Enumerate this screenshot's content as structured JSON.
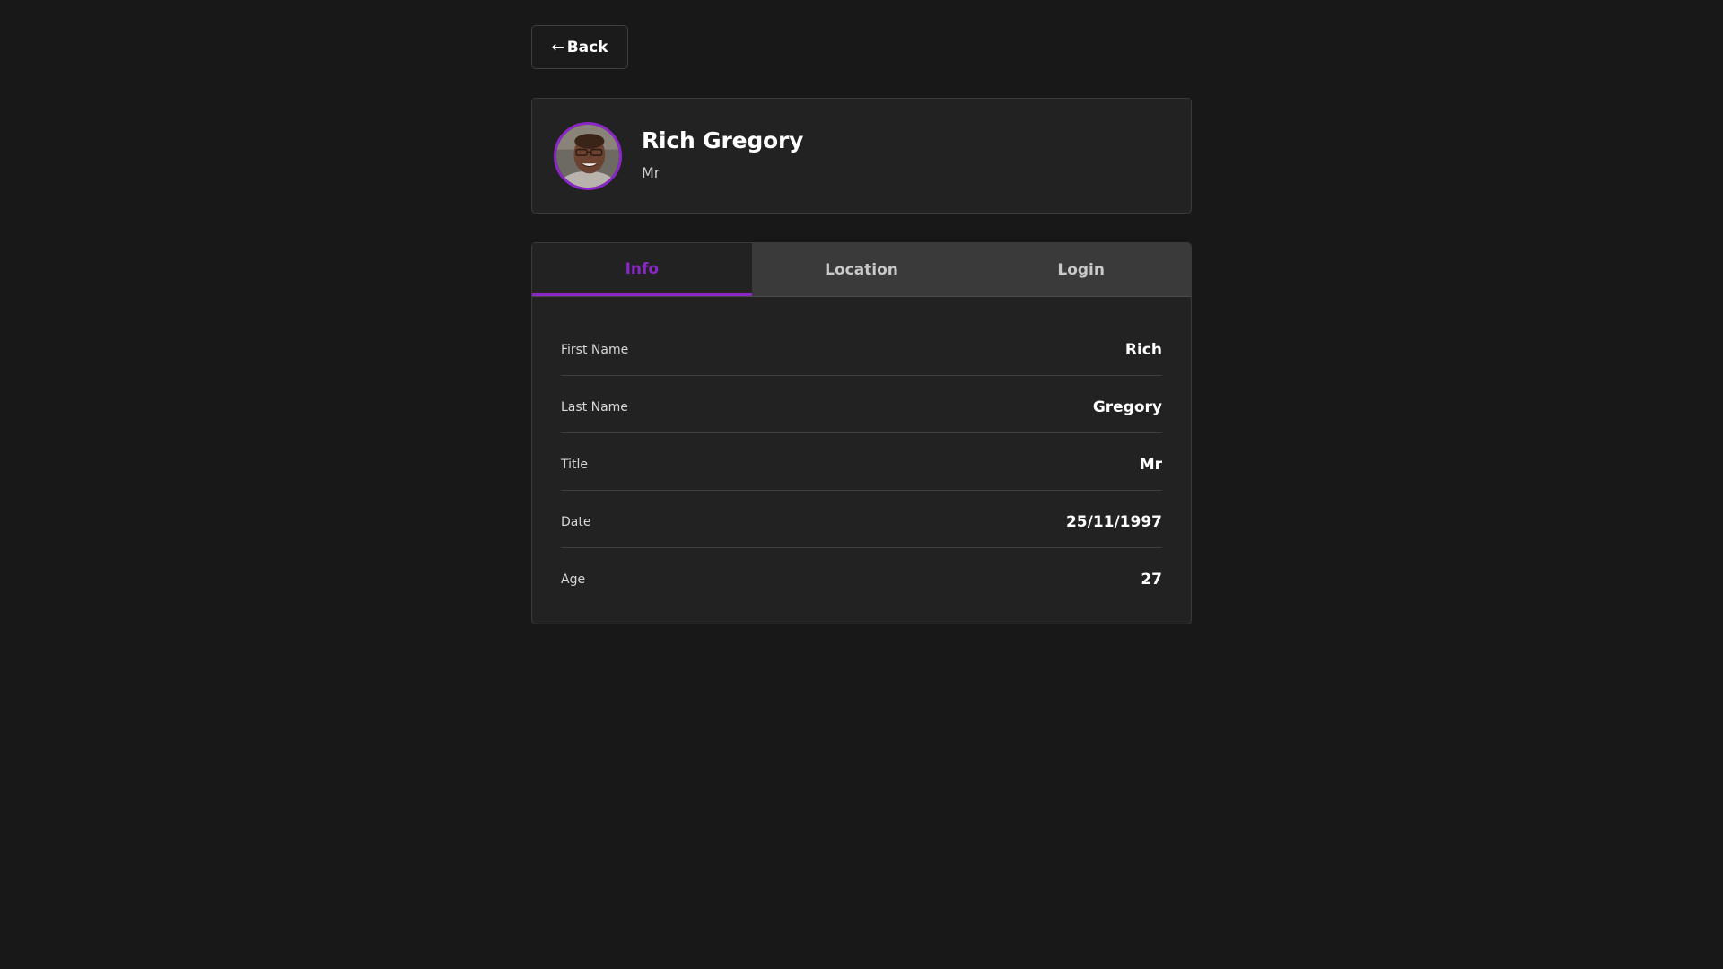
{
  "back_button": {
    "arrow": "←",
    "label": "Back"
  },
  "profile": {
    "name": "Rich Gregory",
    "title": "Mr"
  },
  "tabs": [
    {
      "label": "Info",
      "active": true
    },
    {
      "label": "Location",
      "active": false
    },
    {
      "label": "Login",
      "active": false
    }
  ],
  "info_rows": [
    {
      "label": "First Name",
      "value": "Rich"
    },
    {
      "label": "Last Name",
      "value": "Gregory"
    },
    {
      "label": "Title",
      "value": "Mr"
    },
    {
      "label": "Date",
      "value": "25/11/1997"
    },
    {
      "label": "Age",
      "value": "27"
    }
  ],
  "colors": {
    "background": "#181818",
    "card": "#222222",
    "accent": "#8b26c7",
    "tab_bar": "#3a3a3a"
  },
  "icons": {
    "back": "arrow-left-icon",
    "avatar": "user-photo"
  }
}
